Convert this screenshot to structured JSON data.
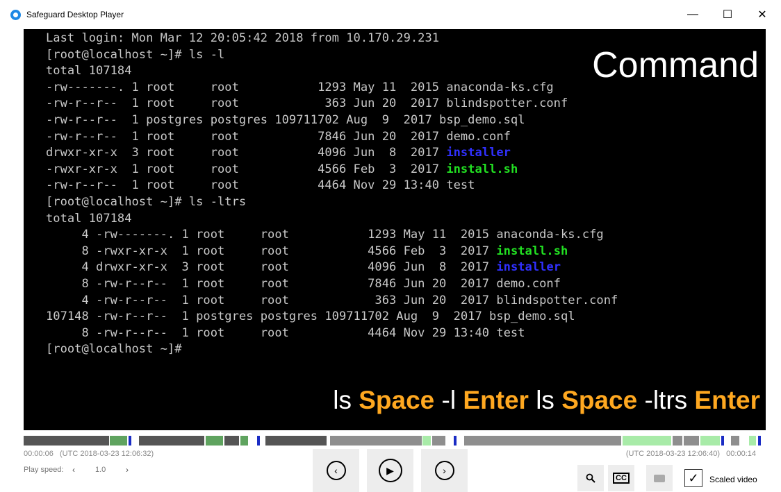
{
  "window": {
    "title": "Safeguard Desktop Player",
    "controls": [
      "minimize-icon",
      "maximize-icon",
      "close-icon"
    ]
  },
  "terminal": {
    "lines": [
      [
        {
          "t": "Last login: Mon Mar 12 20:05:42 2018 from 10.170.29.231"
        }
      ],
      [
        {
          "t": "[root@localhost ~]# ls -l"
        }
      ],
      [
        {
          "t": "total 107184"
        }
      ],
      [
        {
          "t": "-rw-------. 1 root     root           1293 May 11  2015 anaconda-ks.cfg"
        }
      ],
      [
        {
          "t": "-rw-r--r--  1 root     root            363 Jun 20  2017 blindspotter.conf"
        }
      ],
      [
        {
          "t": "-rw-r--r--  1 postgres postgres 109711702 Aug  9  2017 bsp_demo.sql"
        }
      ],
      [
        {
          "t": "-rw-r--r--  1 root     root           7846 Jun 20  2017 demo.conf"
        }
      ],
      [
        {
          "t": "drwxr-xr-x  3 root     root           4096 Jun  8  2017 "
        },
        {
          "t": "installer",
          "c": "dir"
        }
      ],
      [
        {
          "t": "-rwxr-xr-x  1 root     root           4566 Feb  3  2017 "
        },
        {
          "t": "install.sh",
          "c": "exe"
        }
      ],
      [
        {
          "t": "-rw-r--r--  1 root     root           4464 Nov 29 13:40 test"
        }
      ],
      [
        {
          "t": "[root@localhost ~]# ls -ltrs"
        }
      ],
      [
        {
          "t": "total 107184"
        }
      ],
      [
        {
          "t": "     4 -rw-------. 1 root     root           1293 May 11  2015 anaconda-ks.cfg"
        }
      ],
      [
        {
          "t": "     8 -rwxr-xr-x  1 root     root           4566 Feb  3  2017 "
        },
        {
          "t": "install.sh",
          "c": "exe"
        }
      ],
      [
        {
          "t": "     4 drwxr-xr-x  3 root     root           4096 Jun  8  2017 "
        },
        {
          "t": "installer",
          "c": "dir"
        }
      ],
      [
        {
          "t": "     8 -rw-r--r--  1 root     root           7846 Jun 20  2017 demo.conf"
        }
      ],
      [
        {
          "t": "     4 -rw-r--r--  1 root     root            363 Jun 20  2017 blindspotter.conf"
        }
      ],
      [
        {
          "t": "107148 -rw-r--r--  1 postgres postgres 109711702 Aug  9  2017 bsp_demo.sql"
        }
      ],
      [
        {
          "t": "     8 -rw-r--r--  1 root     root           4464 Nov 29 13:40 test"
        }
      ],
      [
        {
          "t": "[root@localhost ~]#"
        }
      ]
    ],
    "overlay_title": "Command",
    "overlay_keys": [
      {
        "t": "ls ",
        "key": false
      },
      {
        "t": "Space",
        "key": true
      },
      {
        "t": " -l ",
        "key": false
      },
      {
        "t": "Enter",
        "key": true
      },
      {
        "t": " ls ",
        "key": false
      },
      {
        "t": "Space",
        "key": true
      },
      {
        "t": " -ltrs ",
        "key": false
      },
      {
        "t": "Enter",
        "key": true
      }
    ]
  },
  "player": {
    "elapsed": "00:00:06",
    "start_utc": "(UTC 2018-03-23 12:06:32)",
    "end_utc": "(UTC 2018-03-23 12:06:40)",
    "total": "00:00:14",
    "speed_label": "Play speed:",
    "speed_value": "1.0",
    "speed_down": "‹",
    "speed_up": "›",
    "scaled_video_label": "Scaled video",
    "scaled_video_checked": true,
    "cc_label": "CC",
    "icons": [
      "rewind-icon",
      "play-icon",
      "forward-icon",
      "search-icon",
      "closed-captions-icon",
      "subtitles-icon",
      "checkmark-icon"
    ],
    "colors": {
      "timeline_active": "#555555",
      "timeline_typing": "#5fa35f",
      "timeline_idle": "#8e8e8e",
      "timeline_light": "#a8eba8",
      "timeline_marker": "#1a2cc4",
      "key_highlight": "#ffa820"
    }
  }
}
